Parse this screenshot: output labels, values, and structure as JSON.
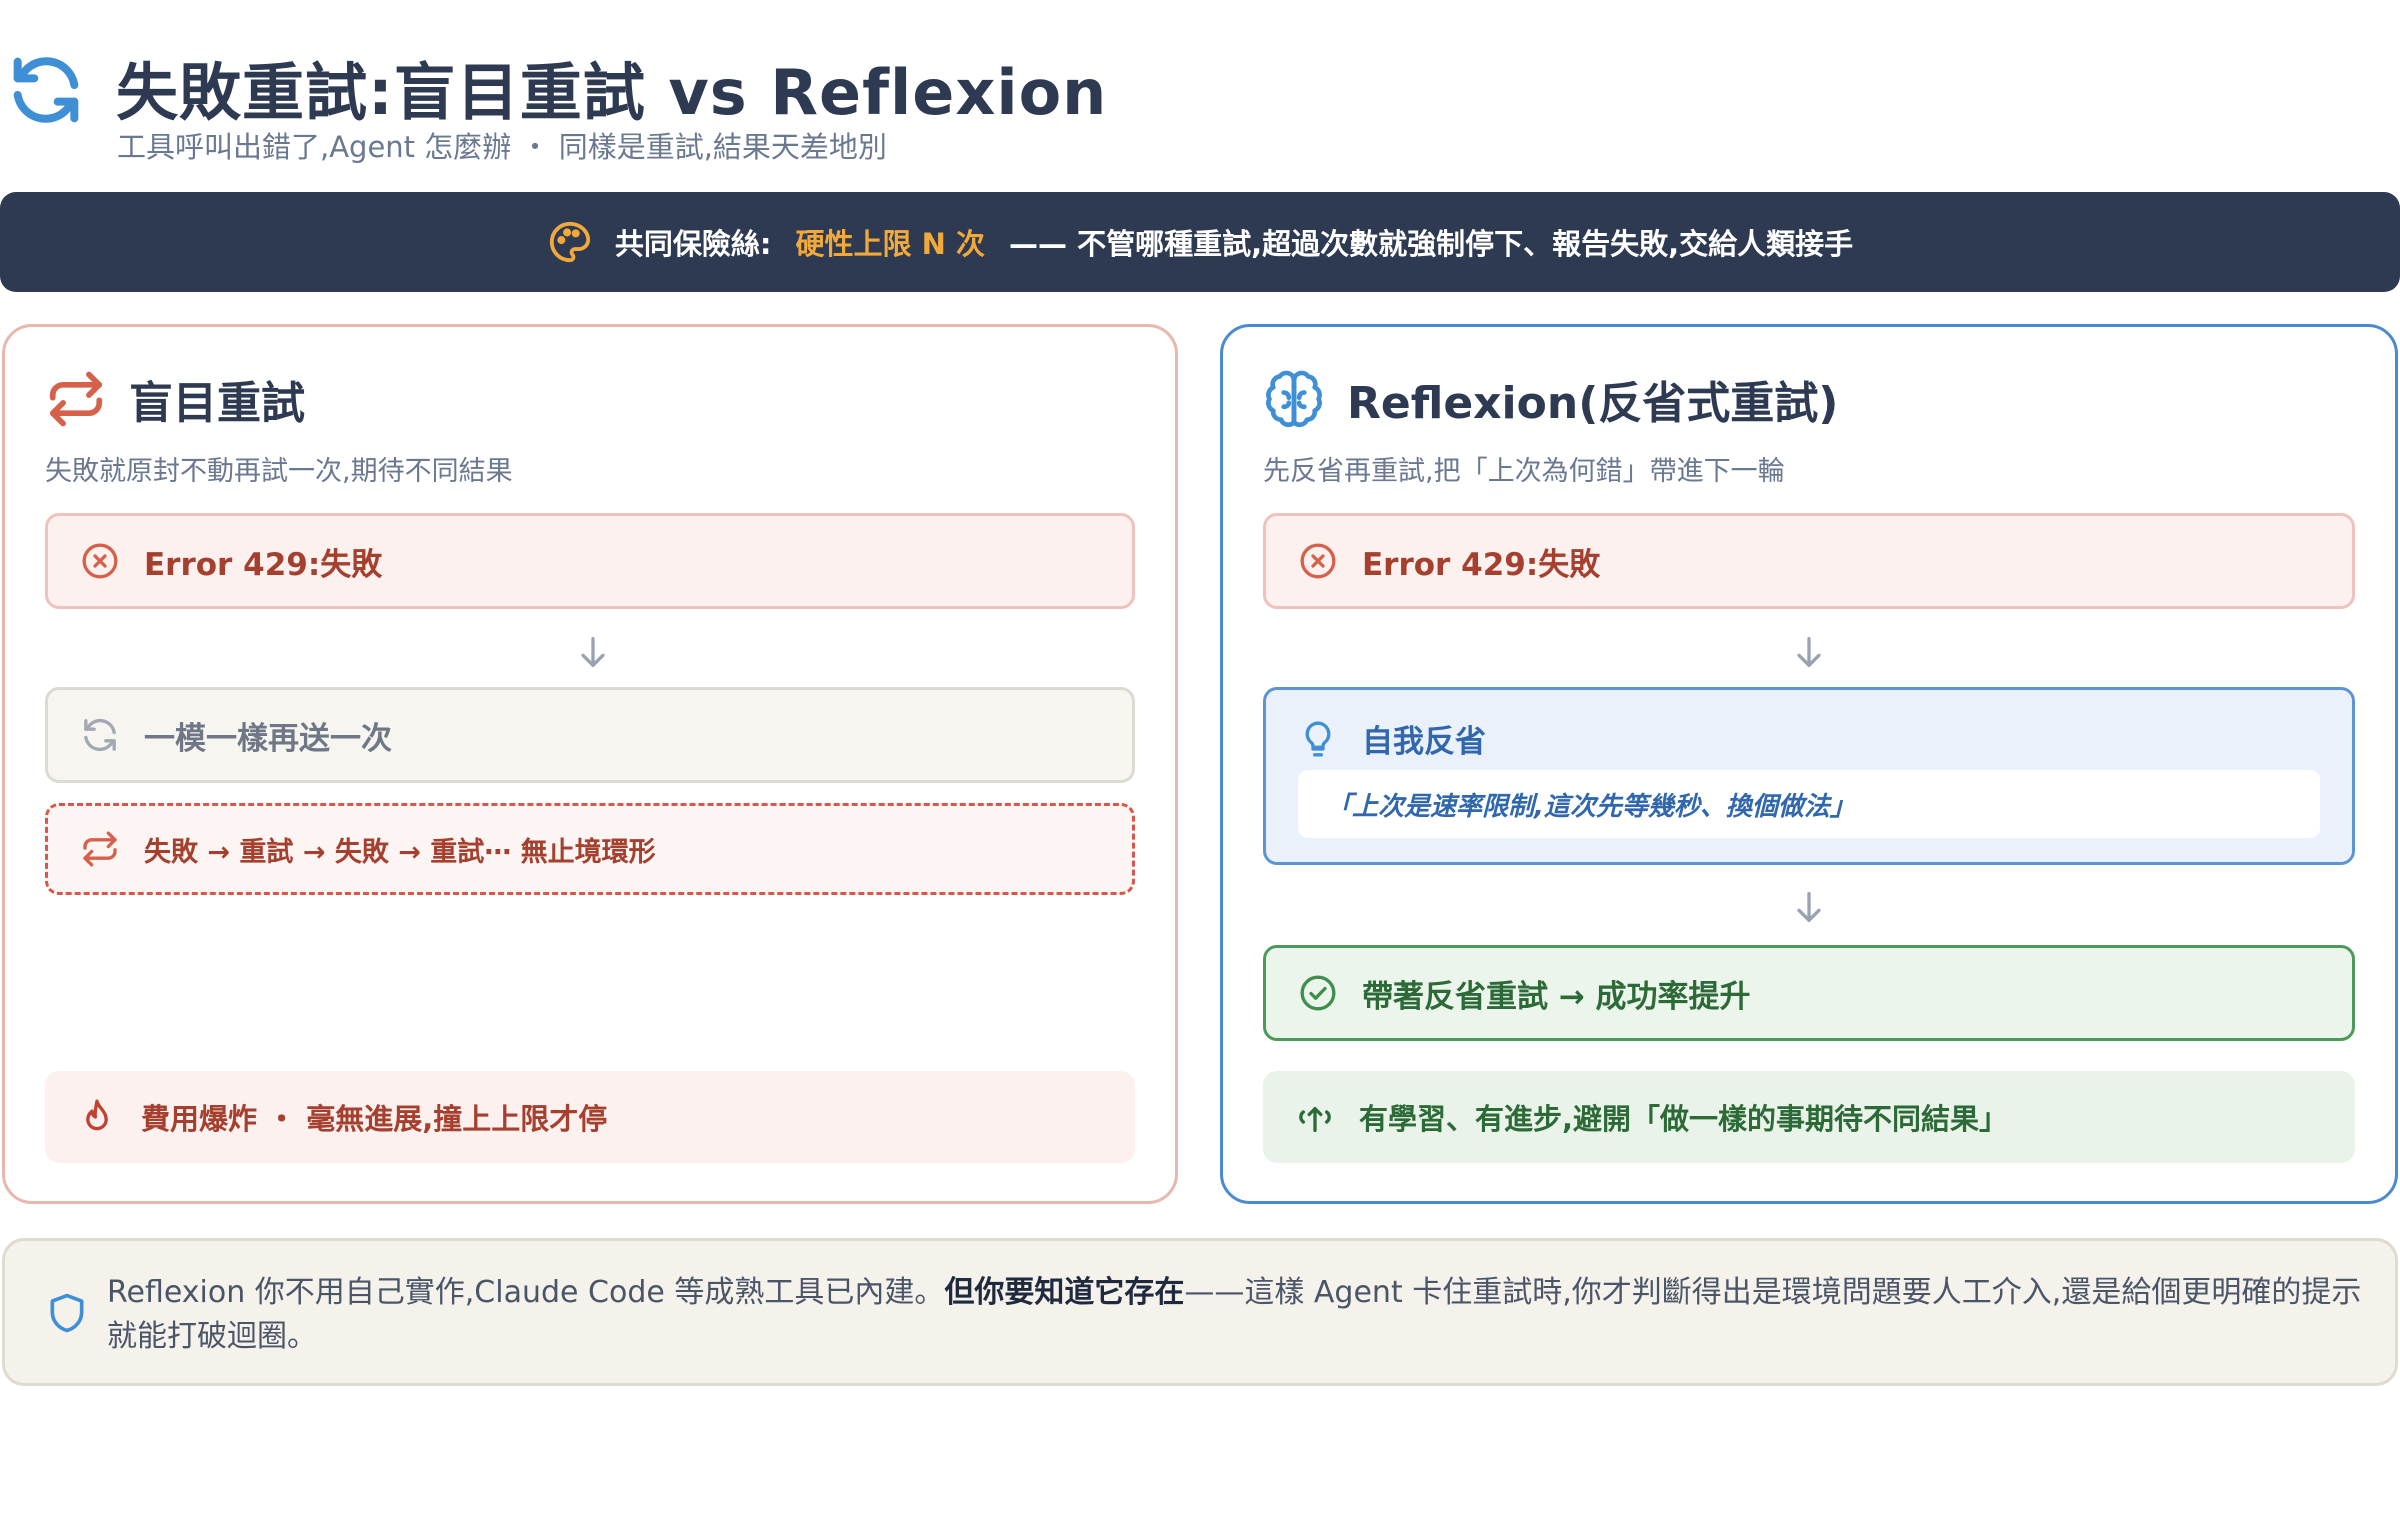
{
  "header": {
    "title": "失敗重試:盲目重試 vs Reflexion",
    "subtitle": "工具呼叫出錯了,Agent 怎麼辦 ・ 同樣是重試,結果天差地別"
  },
  "banner": {
    "label": "共同保險絲:",
    "highlight": "硬性上限 N 次",
    "text": "—— 不管哪種重試,超過次數就強制停下、報告失敗,交給人類接手"
  },
  "left_panel": {
    "title": "盲目重試",
    "description": "失敗就原封不動再試一次,期待不同結果",
    "error": "Error 429:失敗",
    "retry": "一模一樣再送一次",
    "loop": "失敗 → 重試 → 失敗 → 重試⋯ 無止境環形",
    "outcome": "費用爆炸 ・ 毫無進展,撞上上限才停"
  },
  "right_panel": {
    "title": "Reflexion(反省式重試)",
    "description": "先反省再重試,把「上次為何錯」帶進下一輪",
    "error": "Error 429:失敗",
    "reflect_title": "自我反省",
    "reflect_quote": "「上次是速率限制,這次先等幾秒、換個做法」",
    "success": "帶著反省重試 → 成功率提升",
    "outcome": "有學習、有進步,避開「做一樣的事期待不同結果」"
  },
  "footer": {
    "text_before": "Reflexion 你不用自己實作,Claude Code 等成熟工具已內建。",
    "text_bold": "但你要知道它存在",
    "text_after": "——這樣 Agent 卡住重試時,你才判斷得出是環境問題要人工介入,還是給個更明確的提示就能打破迴圈。"
  },
  "colors": {
    "navy": "#2d3a52",
    "accent_orange": "#f2a93b",
    "error_red": "#a5402f",
    "reflect_blue": "#3168ad",
    "success_green": "#2c6a38"
  },
  "icons": [
    "refresh-icon",
    "palette-icon",
    "swap-arrows-icon",
    "brain-icon",
    "x-circle-icon",
    "arrow-down-icon",
    "retry-icon",
    "lightbulb-icon",
    "check-circle-icon",
    "flame-icon",
    "growth-icon",
    "shield-icon"
  ]
}
